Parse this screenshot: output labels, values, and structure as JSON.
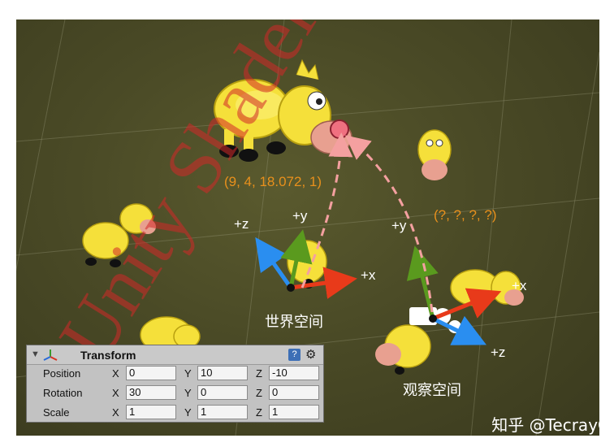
{
  "watermark": "Unity Shader",
  "labels": {
    "world_z": "+z",
    "world_y": "+y",
    "world_x": "+x",
    "view_y": "+y",
    "view_x": "+x",
    "view_z": "+z",
    "world_coord": "(9, 4, 18.072, 1)",
    "view_coord": "(?, ?, ?, ?)",
    "world_space": "世界空间",
    "view_space": "观察空间"
  },
  "credit": "知乎 @TecrayC",
  "colors": {
    "x_axis": "#e83a1a",
    "y_axis": "#5a9a1e",
    "z_axis": "#2a8ef0",
    "cow": "#f5e03a",
    "dashed": "#f4a0a0",
    "coord_text": "#e8901c"
  },
  "inspector": {
    "title": "Transform",
    "help_icon": "help-book-icon",
    "gear_icon": "gear-icon",
    "rows": [
      {
        "name": "Position",
        "x_label": "X",
        "x": "0",
        "y_label": "Y",
        "y": "10",
        "z_label": "Z",
        "z": "-10"
      },
      {
        "name": "Rotation",
        "x_label": "X",
        "x": "30",
        "y_label": "Y",
        "y": "0",
        "z_label": "Z",
        "z": "0"
      },
      {
        "name": "Scale",
        "x_label": "X",
        "x": "1",
        "y_label": "Y",
        "y": "1",
        "z_label": "Z",
        "z": "1"
      }
    ]
  }
}
